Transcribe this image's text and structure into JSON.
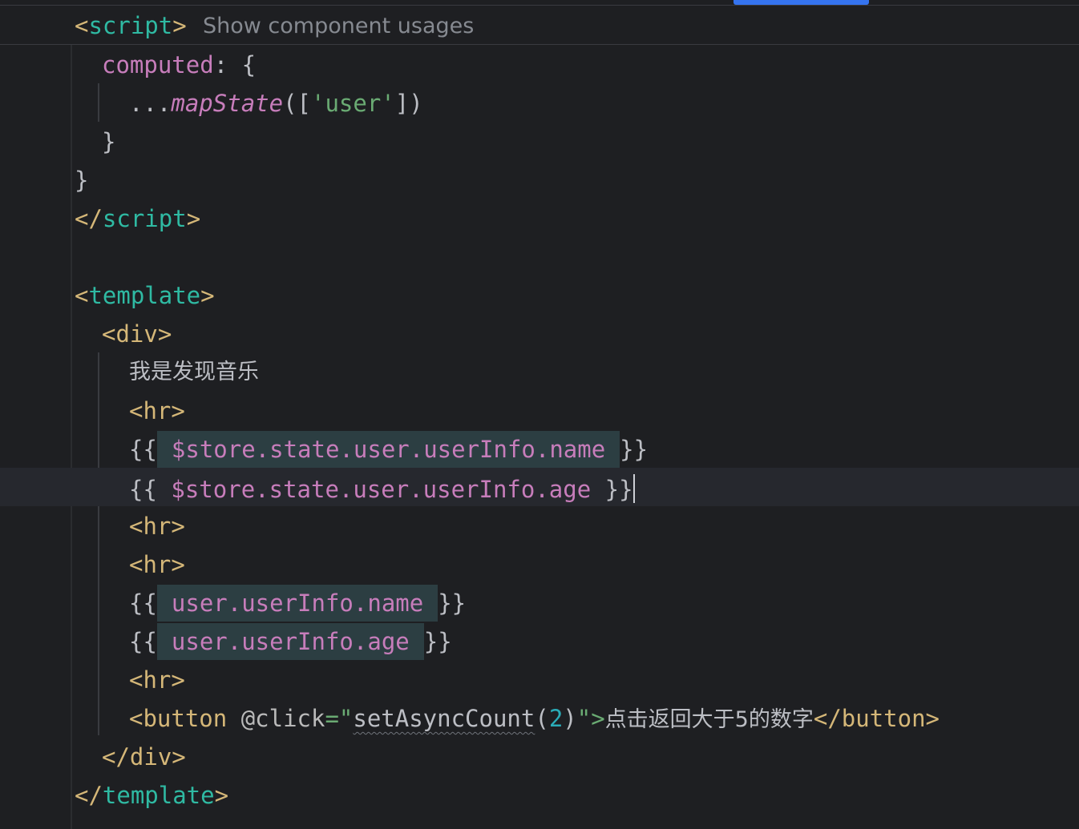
{
  "sticky": {
    "tag_open": "<",
    "tag_name": "script",
    "tag_close": ">",
    "hint": "Show component usages"
  },
  "lines": {
    "l1_key": "computed",
    "l1_rest": ": {",
    "l2_spread": "...",
    "l2_fn": "mapState",
    "l2_open": "([",
    "l2_str": "'user'",
    "l2_close": "])",
    "l3": "}",
    "l4": "}",
    "l5_open": "</",
    "l5_name": "script",
    "l5_close": ">",
    "l7_open": "<",
    "l7_name": "template",
    "l7_close": ">",
    "l8": "<div>",
    "l9": "我是发现音乐",
    "l10": "<hr>",
    "l11_open": "{{",
    "l11_expr": "$store.state.user.userInfo.name",
    "l11_close": "}}",
    "l12_open": "{{",
    "l12_expr": "$store.state.user.userInfo.age",
    "l12_close": "}}",
    "l13": "<hr>",
    "l14": "<hr>",
    "l15_open": "{{",
    "l15_expr": "user.userInfo.name",
    "l15_close": "}}",
    "l16_open": "{{",
    "l16_expr": "user.userInfo.age",
    "l16_close": "}}",
    "l17": "<hr>",
    "l18_tag": "<button",
    "l18_attr": "@click",
    "l18_eq": "=\"",
    "l18_fn": "setAsyncCount",
    "l18_p1": "(",
    "l18_num": "2",
    "l18_p2": ")",
    "l18_q": "\">",
    "l18_text": "点击返回大于5的数字",
    "l18_end": "</button>",
    "l19": "</div>",
    "l20_open": "</",
    "l20_name": "template",
    "l20_close": ">"
  }
}
